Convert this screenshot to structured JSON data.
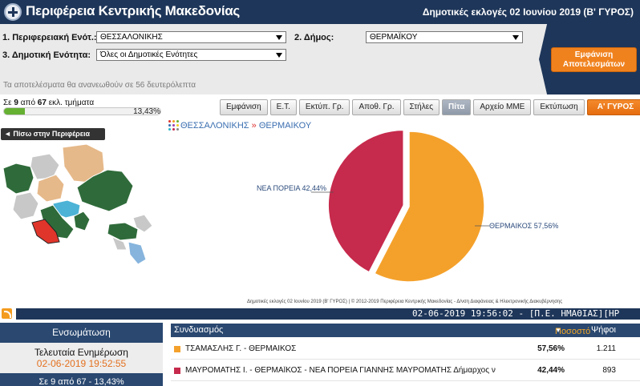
{
  "header": {
    "title": "Περιφέρεια Κεντρικής Μακεδονίας",
    "election": "Δημοτικές εκλογές 02 Ιουνίου 2019 (Β' ΓΥΡΟΣ)"
  },
  "filters": {
    "regional_unit_label": "1. Περιφερειακή Ενότ.:",
    "regional_unit_value": "ΘΕΣΣΑΛΟΝΙΚΗΣ",
    "municipality_label": "2. Δήμος:",
    "municipality_value": "ΘΕΡΜΑΪΚΟΥ",
    "municipal_unit_label": "3. Δημοτική Ενότητα:",
    "municipal_unit_value": "Όλες οι Δημοτικές Ενότητες",
    "refresh_notice": "Τα αποτελέσματα θα ανανεωθούν σε 56 δευτερόλεπτα",
    "show_button": "Εμφάνιση Αποτελεσμάτων"
  },
  "progress": {
    "prefix": "Σε ",
    "counted": "9",
    "middle": " από ",
    "total": "67",
    "suffix": " εκλ. τμήματα",
    "percent_label": "13,43%",
    "percent": 13.43
  },
  "toolbar": {
    "buttons": [
      "Εμφάνιση",
      "Ε.Τ.",
      "Εκτύπ. Γρ.",
      "Αποθ. Γρ.",
      "Στήλες",
      "Πίτα",
      "Αρχείο ΜΜΕ",
      "Εκτύπωση",
      "Α' ΓΥΡΟΣ"
    ]
  },
  "nav": {
    "back": "◄ Πίσω στην Περιφέρεια",
    "crumb_region": "ΘΕΣΣΑΛΟΝΙΚΗΣ",
    "crumb_sep": " » ",
    "crumb_municipality": "ΘΕΡΜΑΙΚΟΥ"
  },
  "chart_data": {
    "type": "pie",
    "slices": [
      {
        "label": "ΘΕΡΜΑΙΚΟΣ 57,56%",
        "value": 57.56,
        "color": "#f4a12b"
      },
      {
        "label": "ΝΕΑ ΠΟΡΕΙΑ 42,44%",
        "value": 42.44,
        "color": "#c62a4c"
      }
    ]
  },
  "footer_note": "Δημοτικές εκλογές 02 Ιουνίου 2019 (Β' ΓΥΡΟΣ) | © 2012-2019 Περιφέρεια Κεντρικής Μακεδονίας - Δ/νση Διαφάνειας & Ηλεκτρονικής Διακυβέρνησης",
  "ticker": "02-06-2019 19:56:02 - [Π.Ε. ΗΜΑΘΙΑΣ][ΗΡ",
  "info": {
    "head": "Ενσωμάτωση",
    "last_update_label": "Τελευταία Ενημέρωση",
    "last_update": "02-06-2019 19:52:55",
    "foot": "Σε 9 από 67 - 13,43%"
  },
  "table": {
    "col_combination": "Συνδυασμός",
    "col_percent": "Ποσοστό",
    "col_votes": "Ψήφοι",
    "rows": [
      {
        "name": "ΤΣΑΜΑΣΛΗΣ Γ. - ΘΕΡΜΑΙΚΟΣ",
        "percent": "57,56%",
        "votes": "1.211",
        "color": "#f4a12b"
      },
      {
        "name": "ΜΑΥΡΟΜΑΤΗΣ Ι. - ΘΕΡΜΑΪΚΟΣ - ΝΕΑ ΠΟΡΕΙΑ ΓΙΑΝΝΗΣ ΜΑΥΡΟΜΑΤΗΣ Δήμαρχος ν",
        "percent": "42,44%",
        "votes": "893",
        "color": "#c62a4c"
      }
    ]
  },
  "colors": {
    "navy": "#1e3659",
    "orange": "#f0821e",
    "green_dark": "#2f6b3a",
    "map_peach": "#e6b98a",
    "map_red": "#e0352b",
    "map_blue": "#86b4dd"
  }
}
